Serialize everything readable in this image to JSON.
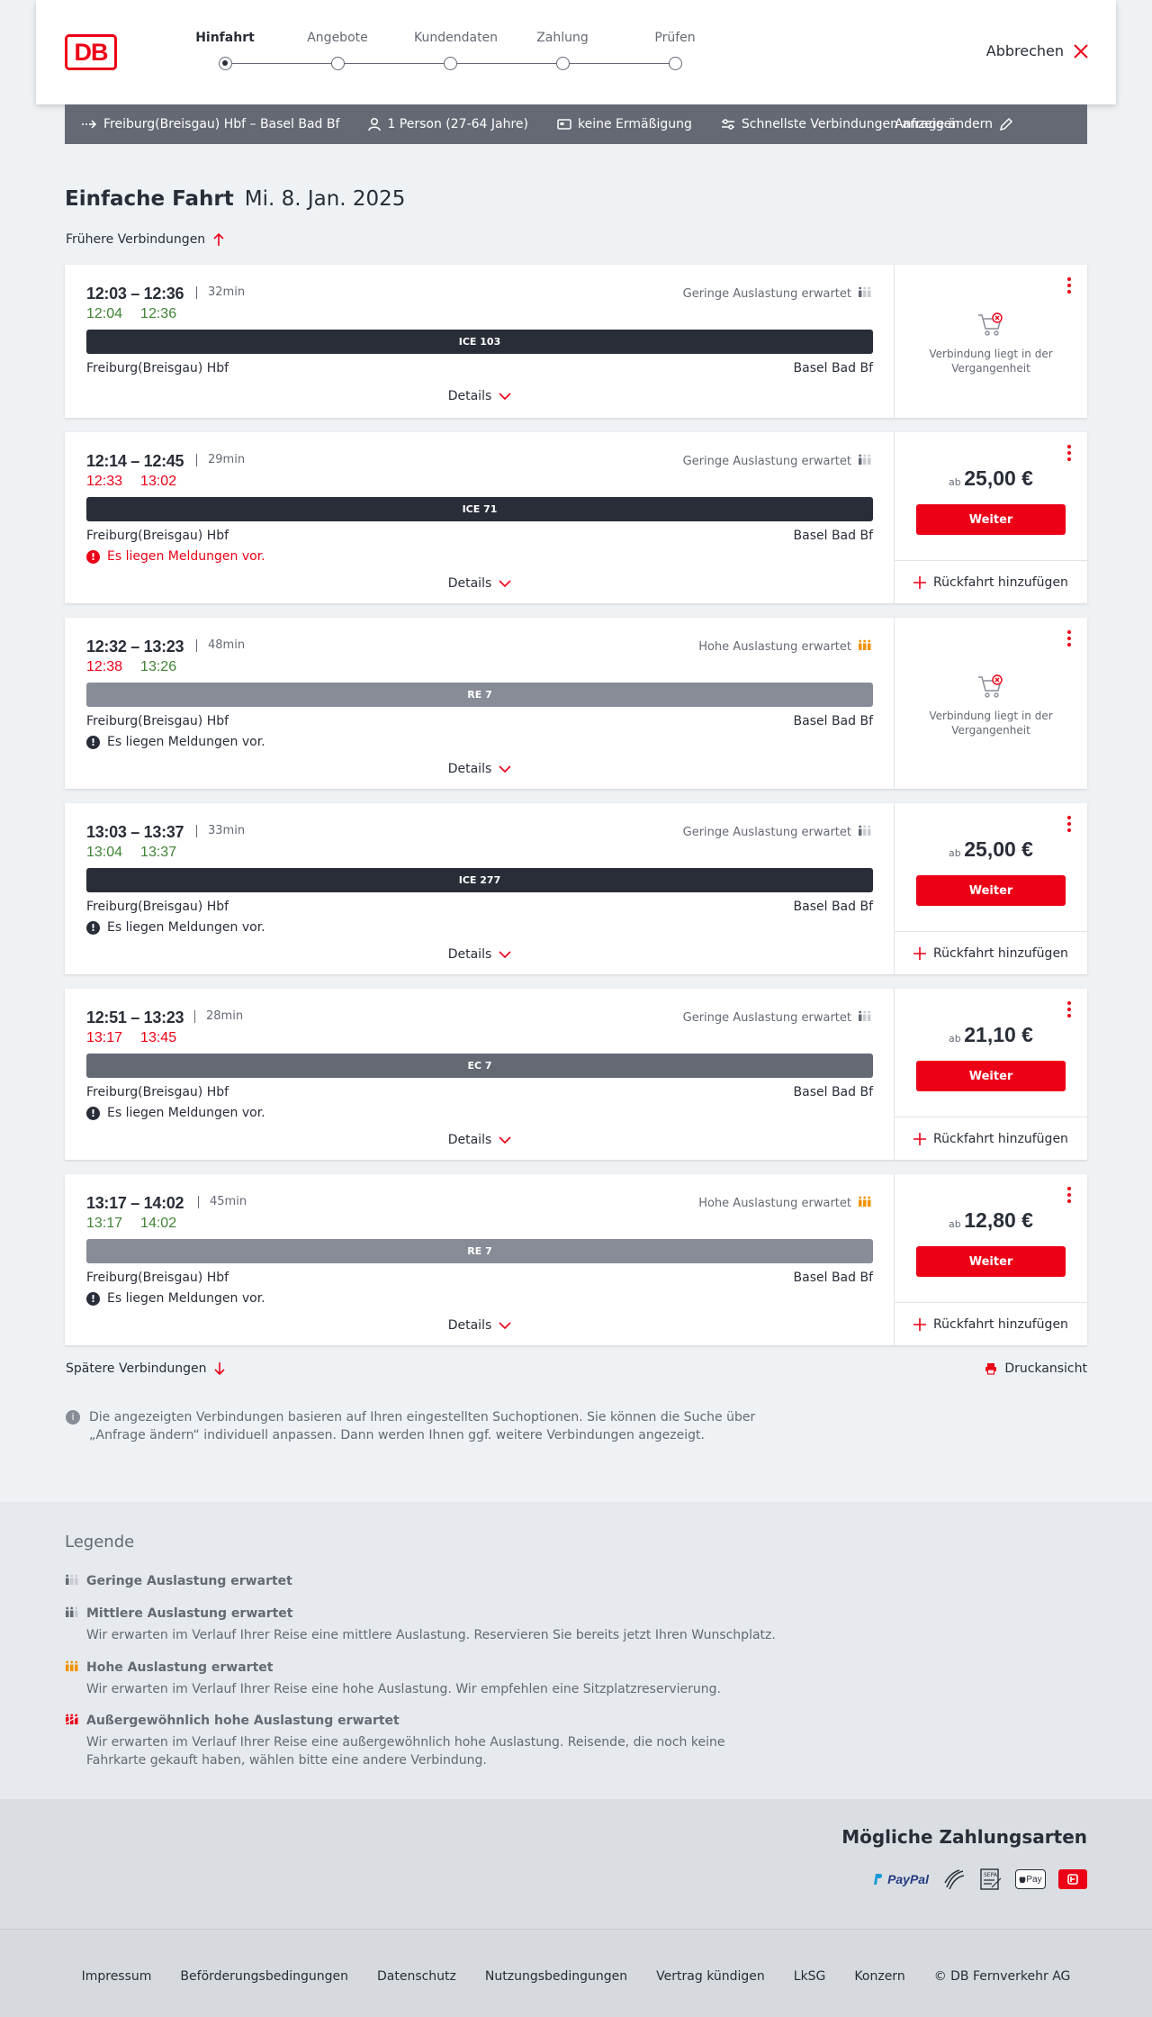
{
  "header": {
    "logo_text": "DB",
    "steps": [
      "Hinfahrt",
      "Angebote",
      "Kundendaten",
      "Zahlung",
      "Prüfen"
    ],
    "active_step": 0,
    "cancel_label": "Abbrechen"
  },
  "query": {
    "route": "Freiburg(Breisgau) Hbf – Basel Bad Bf",
    "passengers": "1 Person (27-64 Jahre)",
    "discount": "keine Ermäßigung",
    "fastest": "Schnellste Verbindungen anzeigen",
    "change_label": "Anfrage ändern"
  },
  "page": {
    "title": "Einfache Fahrt",
    "date": "Mi. 8. Jan. 2025",
    "earlier_label": "Frühere Verbindungen",
    "later_label": "Spätere Verbindungen",
    "print_label": "Druckansicht",
    "info_text": "Die angezeigten Verbindungen basieren auf Ihren eingestellten Suchoptionen. Sie können die Suche über „Anfrage ändern“ individuell anpassen. Dann werden Ihnen ggf. weitere Verbindungen angezeigt."
  },
  "labels": {
    "details": "Details",
    "weiter": "Weiter",
    "ruckfahrt": "Rückfahrt hinzufügen",
    "ab": "ab",
    "past_line1": "Verbindung liegt in der",
    "past_line2": "Vergangenheit"
  },
  "connections": [
    {
      "times": "12:03 – 12:36",
      "duration": "32min",
      "rt_dep": "12:04",
      "rt_arr": "12:36",
      "rt_dep_status": "green",
      "rt_arr_status": "green",
      "load": "Geringe Auslastung erwartet",
      "load_level": "low",
      "train": "ICE 103",
      "train_color": "#282d37",
      "from": "Freiburg(Breisgau) Hbf",
      "to": "Basel Bad Bf",
      "message": "",
      "past": true,
      "price": ""
    },
    {
      "times": "12:14 – 12:45",
      "duration": "29min",
      "rt_dep": "12:33",
      "rt_arr": "13:02",
      "rt_dep_status": "red",
      "rt_arr_status": "red",
      "load": "Geringe Auslastung erwartet",
      "load_level": "low",
      "train": "ICE 71",
      "train_color": "#282d37",
      "from": "Freiburg(Breisgau) Hbf",
      "to": "Basel Bad Bf",
      "message": "Es liegen Meldungen vor.",
      "message_color": "#ec0016",
      "past": false,
      "price": "25,00 €"
    },
    {
      "times": "12:32 – 13:23",
      "duration": "48min",
      "rt_dep": "12:38",
      "rt_arr": "13:26",
      "rt_dep_status": "red",
      "rt_arr_status": "green",
      "load": "Hohe Auslastung erwartet",
      "load_level": "high",
      "train": "RE 7",
      "train_color": "#878c96",
      "from": "Freiburg(Breisgau) Hbf",
      "to": "Basel Bad Bf",
      "message": "Es liegen Meldungen vor.",
      "message_color": "#282d37",
      "past": true,
      "price": ""
    },
    {
      "times": "13:03 – 13:37",
      "duration": "33min",
      "rt_dep": "13:04",
      "rt_arr": "13:37",
      "rt_dep_status": "green",
      "rt_arr_status": "green",
      "load": "Geringe Auslastung erwartet",
      "load_level": "low",
      "train": "ICE 277",
      "train_color": "#282d37",
      "from": "Freiburg(Breisgau) Hbf",
      "to": "Basel Bad Bf",
      "message": "Es liegen Meldungen vor.",
      "message_color": "#282d37",
      "past": false,
      "price": "25,00 €"
    },
    {
      "times": "12:51 – 13:23",
      "duration": "28min",
      "rt_dep": "13:17",
      "rt_arr": "13:45",
      "rt_dep_status": "red",
      "rt_arr_status": "red",
      "load": "Geringe Auslastung erwartet",
      "load_level": "low",
      "train": "EC 7",
      "train_color": "#646973",
      "from": "Freiburg(Breisgau) Hbf",
      "to": "Basel Bad Bf",
      "message": "Es liegen Meldungen vor.",
      "message_color": "#282d37",
      "past": false,
      "price": "21,10 €"
    },
    {
      "times": "13:17 – 14:02",
      "duration": "45min",
      "rt_dep": "13:17",
      "rt_arr": "14:02",
      "rt_dep_status": "green",
      "rt_arr_status": "green",
      "load": "Hohe Auslastung erwartet",
      "load_level": "high",
      "train": "RE 7",
      "train_color": "#878c96",
      "from": "Freiburg(Breisgau) Hbf",
      "to": "Basel Bad Bf",
      "message": "Es liegen Meldungen vor.",
      "message_color": "#282d37",
      "past": false,
      "price": "12,80 €"
    }
  ],
  "legend": {
    "title": "Legende",
    "items": [
      {
        "label": "Geringe Auslastung erwartet",
        "desc": "",
        "level": "low"
      },
      {
        "label": "Mittlere Auslastung erwartet",
        "desc": "Wir erwarten im Verlauf Ihrer Reise eine mittlere Auslastung. Reservieren Sie bereits jetzt Ihren Wunschplatz.",
        "level": "mid"
      },
      {
        "label": "Hohe Auslastung erwartet",
        "desc": "Wir erwarten im Verlauf Ihrer Reise eine hohe Auslastung. Wir empfehlen eine Sitzplatzreservierung.",
        "level": "high"
      },
      {
        "label": "Außergewöhnlich hohe Auslastung erwartet",
        "desc": "Wir erwarten im Verlauf Ihrer Reise eine außergewöhnlich hohe Auslastung. Reisende, die noch keine Fahrkarte gekauft haben, wählen bitte eine andere Verbindung.",
        "level": "extreme"
      }
    ]
  },
  "payment": {
    "title": "Mögliche Zahlungsarten",
    "methods": [
      "PayPal",
      "credit-card-icon",
      "sepa-icon",
      "Apple Pay",
      "db-bonus-icon"
    ],
    "paypal_text": "PayPal",
    "applepay_text": "Pay",
    "sepa_text": "SEPA"
  },
  "footer": {
    "links": [
      "Impressum",
      "Beförderungsbedingungen",
      "Datenschutz",
      "Nutzungsbedingungen",
      "Vertrag kündigen",
      "LkSG",
      "Konzern",
      "© DB Fernverkehr AG"
    ]
  },
  "colors": {
    "accent": "#ec0016",
    "on_time": "#408335",
    "delayed": "#ec0016",
    "high_load": "#f39200",
    "query_bar": "#646973"
  }
}
